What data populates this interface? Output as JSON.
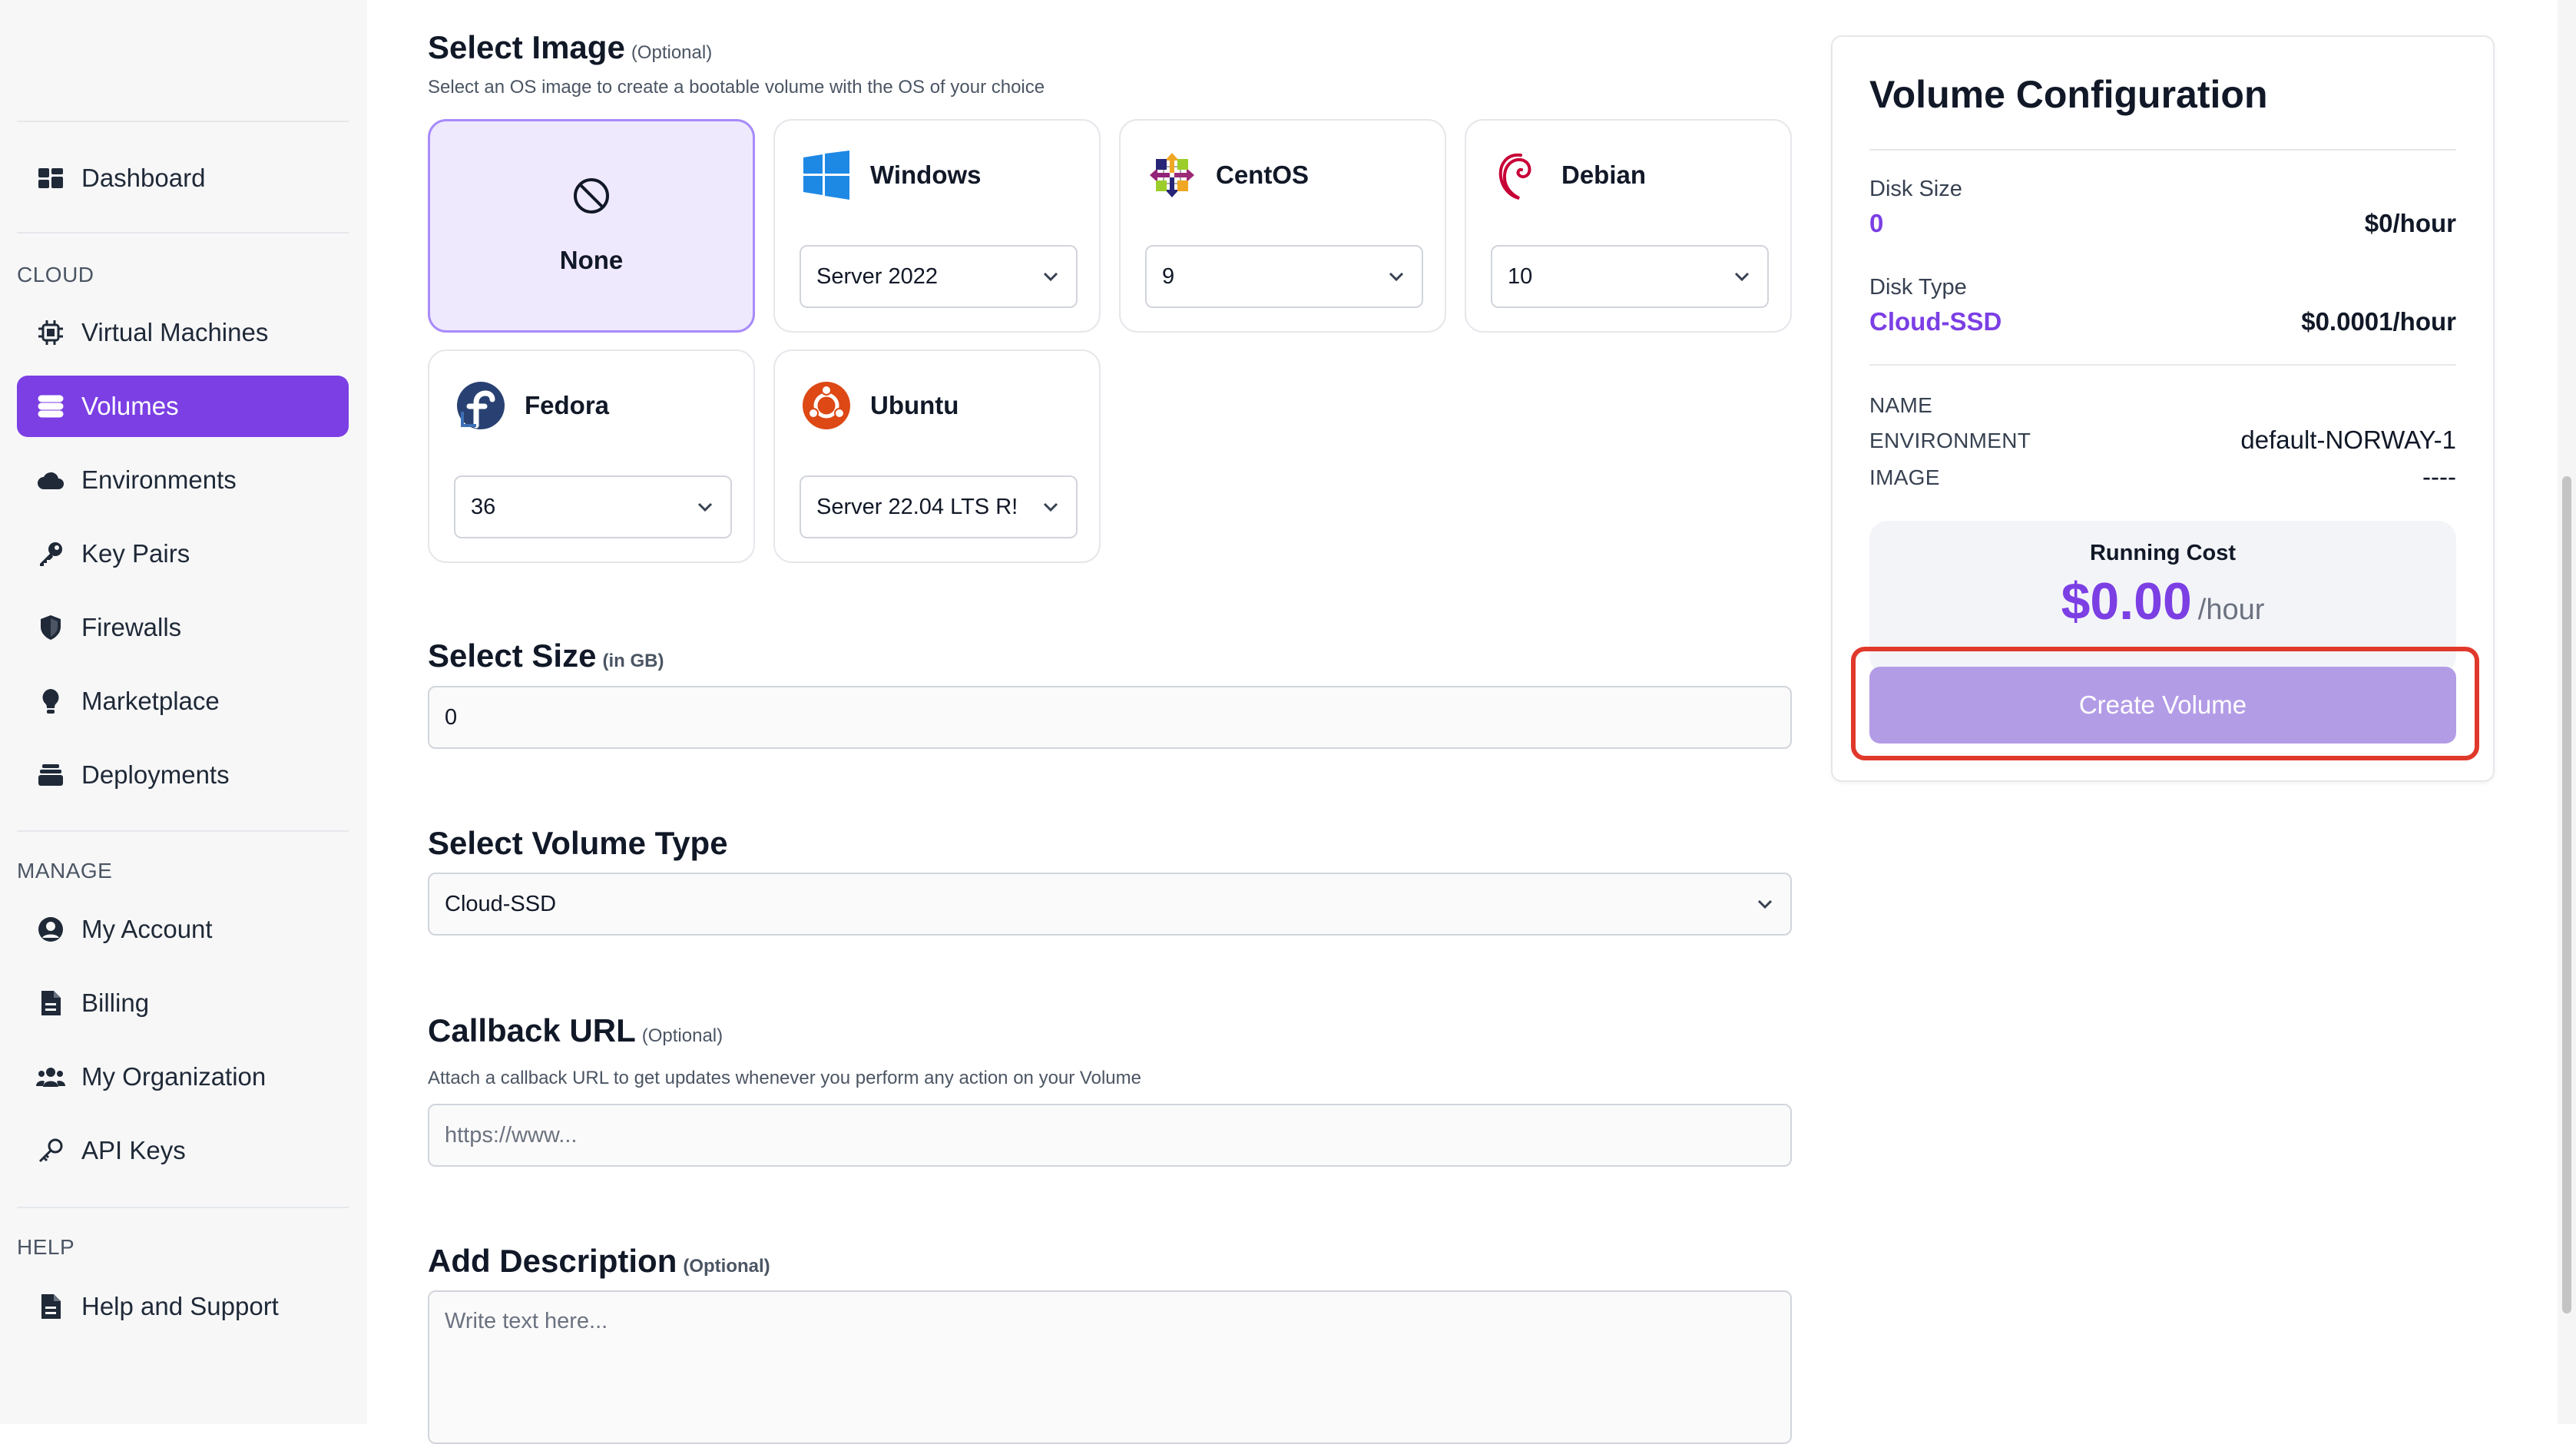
{
  "sidebar": {
    "sections": {
      "cloud": "CLOUD",
      "manage": "MANAGE",
      "help": "HELP"
    },
    "items": {
      "dashboard": "Dashboard",
      "virtual_machines": "Virtual Machines",
      "volumes": "Volumes",
      "environments": "Environments",
      "key_pairs": "Key Pairs",
      "firewalls": "Firewalls",
      "marketplace": "Marketplace",
      "deployments": "Deployments",
      "my_account": "My Account",
      "billing": "Billing",
      "my_organization": "My Organization",
      "api_keys": "API Keys",
      "help_support": "Help and Support"
    },
    "active": "volumes",
    "accent": "#7b3fe4"
  },
  "image": {
    "title": "Select Image",
    "optional": "(Optional)",
    "subtitle": "Select an OS image to create a bootable volume with the OS of your choice",
    "options": {
      "none": {
        "name": "None",
        "icon": "ban-icon"
      },
      "windows": {
        "name": "Windows",
        "version": "Server 2022",
        "icon": "windows-logo-icon"
      },
      "centos": {
        "name": "CentOS",
        "version": "9",
        "icon": "centos-logo-icon"
      },
      "debian": {
        "name": "Debian",
        "version": "10",
        "icon": "debian-logo-icon"
      },
      "fedora": {
        "name": "Fedora",
        "version": "36",
        "icon": "fedora-logo-icon"
      },
      "ubuntu": {
        "name": "Ubuntu",
        "version": "Server 22.04 LTS R!",
        "icon": "ubuntu-logo-icon"
      }
    },
    "selected": "none"
  },
  "size": {
    "title": "Select Size",
    "unit": "(in GB)",
    "value": "0"
  },
  "volume_type": {
    "title": "Select Volume Type",
    "value": "Cloud-SSD"
  },
  "callback": {
    "title": "Callback URL",
    "optional": "(Optional)",
    "subtitle": "Attach a callback URL to get updates whenever you perform any action on your Volume",
    "placeholder": "https://www..."
  },
  "description": {
    "title": "Add Description",
    "optional": "(Optional)",
    "placeholder": "Write text here..."
  },
  "config": {
    "title": "Volume Configuration",
    "disk_size_label": "Disk Size",
    "disk_size_value": "0",
    "disk_size_price": "$0/hour",
    "disk_type_label": "Disk Type",
    "disk_type_value": "Cloud-SSD",
    "disk_type_price": "$0.0001/hour",
    "name_label": "NAME",
    "env_label": "ENVIRONMENT",
    "env_value": "default-NORWAY-1",
    "image_label": "IMAGE",
    "image_value": "----",
    "running_cost_label": "Running Cost",
    "running_cost_value": "$0.00",
    "running_cost_unit": "/hour",
    "create_label": "Create Volume",
    "highlight_color": "#e0392b"
  }
}
